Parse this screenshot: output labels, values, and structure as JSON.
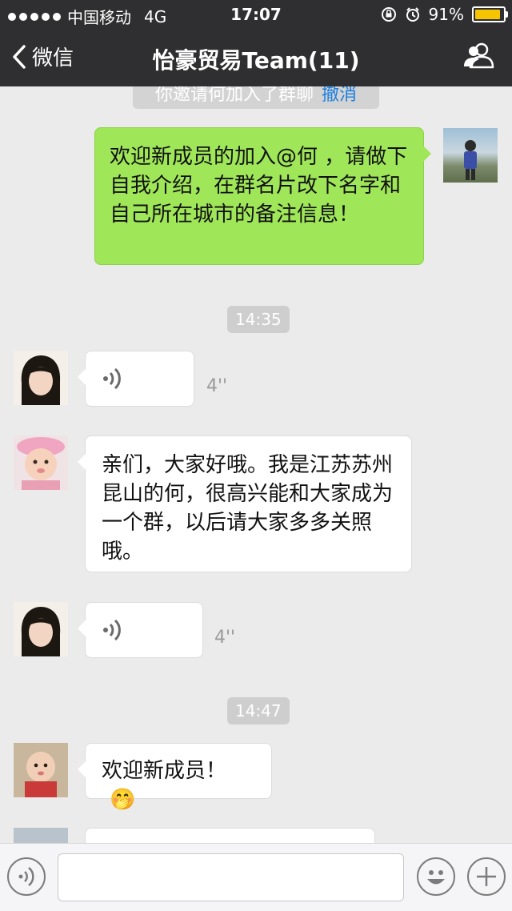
{
  "status_bar": {
    "carrier": "中国移动",
    "network": "4G",
    "time": "17:07",
    "battery": "91%",
    "battery_level": 0.91
  },
  "nav": {
    "back_label": "微信",
    "title": "怡豪贸易Team(11)"
  },
  "system_notice": {
    "text": "你邀请何加入了群聊",
    "action": "撤消"
  },
  "messages": {
    "m1": {
      "text": "欢迎新成员的加入@何 ，请做下自我介绍，在群名片改下名字和自己所在城市的备注信息！"
    },
    "ts1": "14:35",
    "m2": {
      "duration": "4''"
    },
    "m3": {
      "text": "亲们，大家好哦。我是江苏苏州昆山的何，很高兴能和大家成为一个群，以后请大家多多关照哦。"
    },
    "m4": {
      "duration": "4''"
    },
    "ts2": "14:47",
    "m5": {
      "text": "欢迎新成员！",
      "emoji": "🤭"
    }
  },
  "colors": {
    "nav_bg": "#2f2f32",
    "chat_bg": "#ebebeb",
    "my_bubble": "#9fe658",
    "link": "#1c7fe0",
    "battery": "#f7c400"
  },
  "input": {
    "placeholder": ""
  }
}
